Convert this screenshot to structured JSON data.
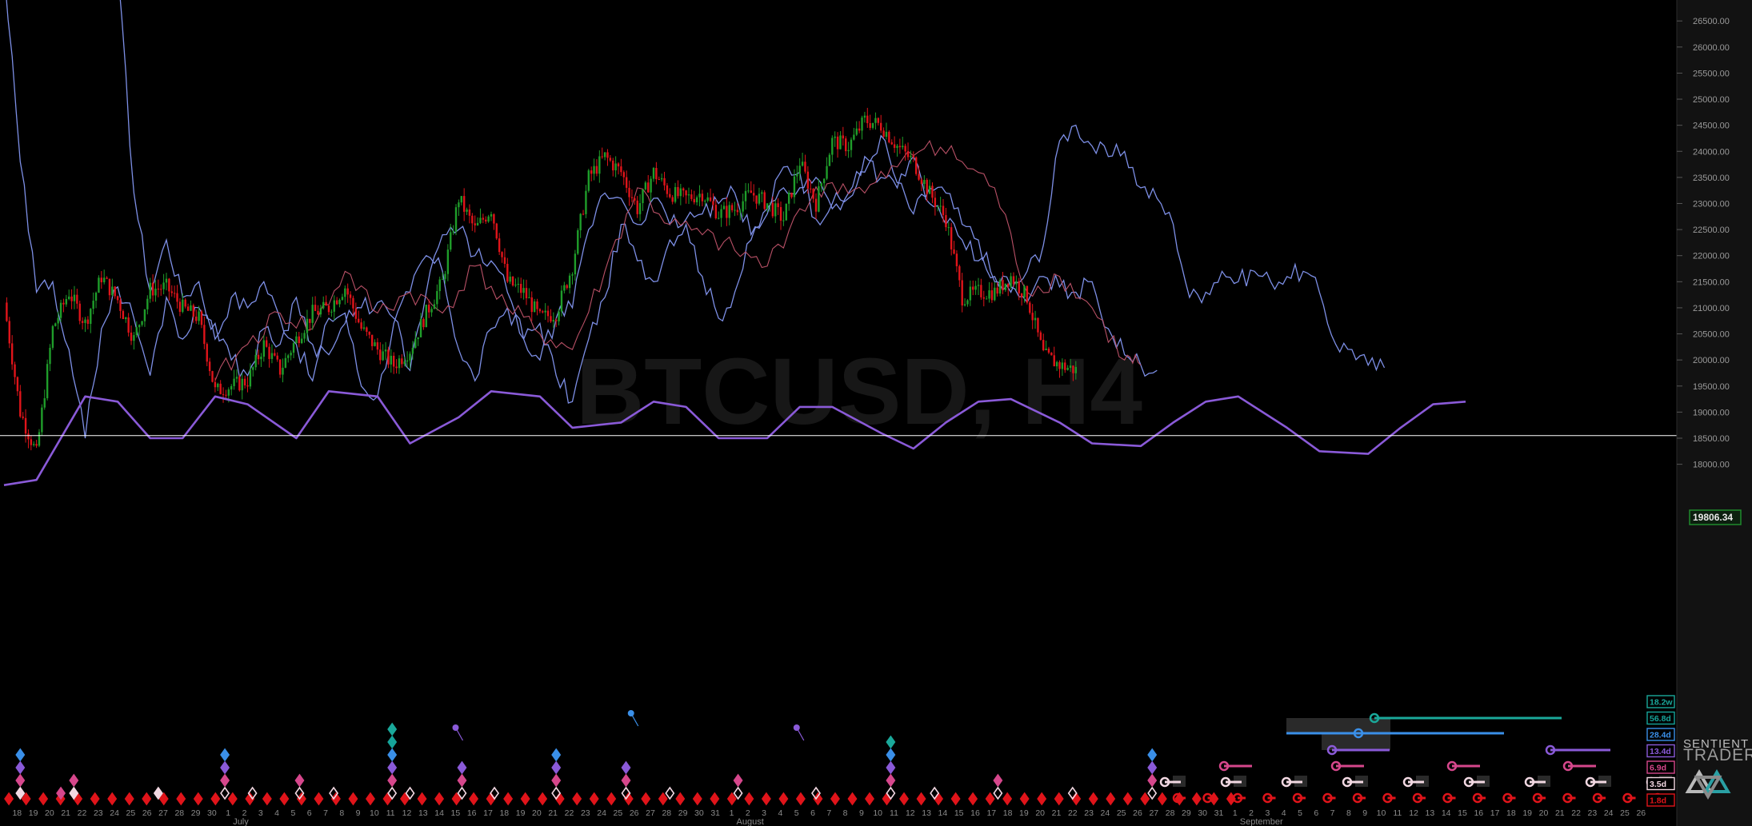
{
  "watermark": "BTCUSD, H4",
  "price_label": "19806.34",
  "brand": {
    "line1": "SENTIENT",
    "line2": "TRADER"
  },
  "colors": {
    "background": "#000000",
    "up_candle": "#1f9d2a",
    "down_candle": "#e0141a",
    "projection_blue": "#7d8fe6",
    "projection_red": "#b85066",
    "cycle_sine": "#8a5ad8",
    "reference_line": "#ffffff",
    "price_box": "#1f8a2c"
  },
  "chart_data": {
    "type": "line",
    "title": "BTCUSD, H4",
    "y_axis": {
      "side": "right",
      "ticks": [
        18000,
        18500,
        19000,
        19500,
        20000,
        20500,
        21000,
        21500,
        22000,
        22500,
        23000,
        23500,
        24000,
        24500,
        25000,
        25500,
        26000,
        26500
      ],
      "tick_labels": [
        "18000.00",
        "18500.00",
        "19000.00",
        "19500.00",
        "20000.00",
        "20500.00",
        "21000.00",
        "21500.00",
        "22000.00",
        "22500.00",
        "23000.00",
        "23500.00",
        "24000.00",
        "24500.00",
        "25000.00",
        "25500.00",
        "26000.00",
        "26500.00"
      ],
      "range": [
        17600,
        26700
      ]
    },
    "x_axis": {
      "day_labels": [
        "18",
        "19",
        "20",
        "21",
        "22",
        "23",
        "24",
        "25",
        "26",
        "27",
        "28",
        "29",
        "30",
        "1",
        "2",
        "3",
        "4",
        "5",
        "6",
        "7",
        "8",
        "9",
        "10",
        "11",
        "12",
        "13",
        "14",
        "15",
        "16",
        "17",
        "18",
        "19",
        "20",
        "21",
        "22",
        "23",
        "24",
        "25",
        "26",
        "27",
        "28",
        "29",
        "30",
        "31",
        "1",
        "2",
        "3",
        "4",
        "5",
        "6",
        "7",
        "8",
        "9",
        "10",
        "11",
        "12",
        "13",
        "14",
        "15",
        "16",
        "17",
        "18",
        "19",
        "20",
        "21",
        "22",
        "23",
        "24",
        "25",
        "26",
        "27",
        "28",
        "29",
        "30",
        "31",
        "1",
        "2",
        "3",
        "4",
        "5",
        "6",
        "7",
        "8",
        "9",
        "10",
        "11",
        "12",
        "13",
        "14",
        "15",
        "16",
        "17",
        "18",
        "19",
        "20",
        "21",
        "22",
        "23",
        "24",
        "25",
        "26"
      ],
      "months": [
        {
          "label": "July",
          "day_index": 13
        },
        {
          "label": "August",
          "day_index": 44
        },
        {
          "label": "September",
          "day_index": 75
        }
      ]
    },
    "price_close": [
      [
        0,
        21100
      ],
      [
        1,
        19000
      ],
      [
        2,
        18200
      ],
      [
        3,
        20600
      ],
      [
        4,
        21300
      ],
      [
        5,
        20700
      ],
      [
        6,
        21600
      ],
      [
        7,
        21150
      ],
      [
        8,
        20400
      ],
      [
        9,
        21350
      ],
      [
        10,
        21400
      ],
      [
        11,
        21000
      ],
      [
        12,
        20800
      ],
      [
        13,
        19400
      ],
      [
        14,
        19500
      ],
      [
        15,
        19600
      ],
      [
        16,
        20300
      ],
      [
        17,
        19800
      ],
      [
        18,
        20400
      ],
      [
        19,
        20900
      ],
      [
        20,
        21000
      ],
      [
        21,
        21400
      ],
      [
        22,
        20600
      ],
      [
        23,
        20200
      ],
      [
        24,
        19900
      ],
      [
        25,
        20200
      ],
      [
        26,
        20900
      ],
      [
        27,
        21500
      ],
      [
        28,
        23100
      ],
      [
        29,
        22500
      ],
      [
        30,
        22900
      ],
      [
        31,
        21500
      ],
      [
        32,
        21300
      ],
      [
        33,
        20800
      ],
      [
        34,
        20900
      ],
      [
        35,
        21800
      ],
      [
        36,
        23500
      ],
      [
        37,
        23900
      ],
      [
        38,
        23600
      ],
      [
        39,
        22900
      ],
      [
        40,
        23600
      ],
      [
        41,
        23200
      ],
      [
        42,
        23100
      ],
      [
        43,
        23200
      ],
      [
        44,
        22800
      ],
      [
        45,
        22900
      ],
      [
        46,
        23200
      ],
      [
        47,
        23000
      ],
      [
        48,
        22700
      ],
      [
        49,
        23800
      ],
      [
        50,
        23000
      ],
      [
        51,
        24200
      ],
      [
        52,
        24100
      ],
      [
        53,
        24600
      ],
      [
        54,
        24500
      ],
      [
        55,
        24100
      ],
      [
        56,
        23800
      ],
      [
        57,
        23200
      ],
      [
        58,
        22700
      ],
      [
        59,
        21200
      ],
      [
        60,
        21300
      ],
      [
        61,
        21300
      ],
      [
        62,
        21600
      ],
      [
        63,
        21200
      ],
      [
        64,
        20100
      ],
      [
        65,
        19900
      ],
      [
        66,
        19806
      ]
    ],
    "projection_red_1": [
      [
        13,
        19600
      ],
      [
        15,
        20300
      ],
      [
        17,
        20900
      ],
      [
        19,
        20600
      ],
      [
        21,
        21700
      ],
      [
        23,
        20900
      ],
      [
        25,
        21300
      ],
      [
        27,
        20900
      ],
      [
        29,
        21800
      ],
      [
        31,
        21000
      ],
      [
        33,
        20500
      ],
      [
        35,
        20200
      ],
      [
        37,
        21700
      ],
      [
        39,
        23300
      ],
      [
        41,
        22600
      ],
      [
        43,
        22400
      ],
      [
        45,
        22100
      ],
      [
        47,
        21800
      ],
      [
        49,
        22900
      ],
      [
        51,
        23400
      ],
      [
        53,
        23200
      ],
      [
        55,
        23700
      ],
      [
        57,
        24200
      ],
      [
        59,
        23800
      ],
      [
        61,
        23300
      ],
      [
        63,
        21300
      ],
      [
        65,
        21600
      ],
      [
        67,
        21000
      ],
      [
        69,
        20000
      ],
      [
        70,
        19900
      ]
    ],
    "projection_blue_1": [
      [
        0,
        27500
      ],
      [
        1,
        23800
      ],
      [
        2,
        21300
      ],
      [
        3,
        21500
      ],
      [
        4,
        20200
      ],
      [
        5,
        18500
      ],
      [
        6,
        20600
      ],
      [
        7,
        21400
      ],
      [
        8,
        20800
      ],
      [
        9,
        19700
      ],
      [
        10,
        21200
      ],
      [
        11,
        20400
      ],
      [
        12,
        21000
      ],
      [
        13,
        20700
      ],
      [
        14,
        20000
      ],
      [
        15,
        19700
      ],
      [
        16,
        20600
      ],
      [
        17,
        20300
      ],
      [
        18,
        21200
      ],
      [
        19,
        20300
      ],
      [
        20,
        20100
      ],
      [
        21,
        20700
      ],
      [
        22,
        21000
      ],
      [
        23,
        21100
      ],
      [
        24,
        20800
      ],
      [
        25,
        19800
      ],
      [
        26,
        21300
      ],
      [
        27,
        22400
      ],
      [
        28,
        22500
      ],
      [
        29,
        22000
      ],
      [
        30,
        21900
      ],
      [
        31,
        21300
      ],
      [
        32,
        20400
      ],
      [
        33,
        20000
      ],
      [
        34,
        20800
      ],
      [
        35,
        21000
      ],
      [
        36,
        22500
      ],
      [
        37,
        23200
      ],
      [
        38,
        23100
      ],
      [
        39,
        22600
      ],
      [
        40,
        23100
      ],
      [
        41,
        22600
      ],
      [
        42,
        22700
      ],
      [
        43,
        22800
      ],
      [
        44,
        23000
      ],
      [
        45,
        23200
      ],
      [
        46,
        22400
      ],
      [
        47,
        22800
      ],
      [
        48,
        23300
      ],
      [
        49,
        23300
      ],
      [
        50,
        23500
      ],
      [
        51,
        22900
      ],
      [
        52,
        23200
      ],
      [
        53,
        23900
      ],
      [
        54,
        23500
      ],
      [
        55,
        23300
      ],
      [
        56,
        23900
      ],
      [
        57,
        23000
      ],
      [
        58,
        22600
      ],
      [
        59,
        22300
      ],
      [
        60,
        21900
      ],
      [
        61,
        21600
      ],
      [
        62,
        21400
      ],
      [
        63,
        21100
      ],
      [
        64,
        21600
      ],
      [
        65,
        21400
      ],
      [
        66,
        21300
      ],
      [
        67,
        21500
      ],
      [
        68,
        20600
      ],
      [
        69,
        20100
      ],
      [
        70,
        19900
      ],
      [
        71,
        19800
      ]
    ],
    "projection_blue_2": [
      [
        7,
        27500
      ],
      [
        8,
        23200
      ],
      [
        9,
        21300
      ],
      [
        10,
        22300
      ],
      [
        11,
        21200
      ],
      [
        12,
        21500
      ],
      [
        13,
        20400
      ],
      [
        14,
        21200
      ],
      [
        15,
        21000
      ],
      [
        16,
        21500
      ],
      [
        17,
        20800
      ],
      [
        18,
        20300
      ],
      [
        19,
        19600
      ],
      [
        20,
        20800
      ],
      [
        21,
        20900
      ],
      [
        22,
        19500
      ],
      [
        23,
        19300
      ],
      [
        24,
        20700
      ],
      [
        25,
        21300
      ],
      [
        26,
        22000
      ],
      [
        27,
        21700
      ],
      [
        28,
        20200
      ],
      [
        29,
        19600
      ],
      [
        30,
        20600
      ],
      [
        31,
        21000
      ],
      [
        32,
        20400
      ],
      [
        33,
        20700
      ],
      [
        34,
        19700
      ],
      [
        35,
        19200
      ],
      [
        36,
        20400
      ],
      [
        37,
        21200
      ],
      [
        38,
        22600
      ],
      [
        39,
        21900
      ],
      [
        40,
        21500
      ],
      [
        41,
        22300
      ],
      [
        42,
        22600
      ],
      [
        43,
        21600
      ],
      [
        44,
        20800
      ],
      [
        45,
        21300
      ],
      [
        46,
        22300
      ],
      [
        47,
        22900
      ],
      [
        48,
        23700
      ],
      [
        49,
        23600
      ],
      [
        50,
        22700
      ],
      [
        51,
        23000
      ],
      [
        52,
        23100
      ],
      [
        53,
        23600
      ],
      [
        54,
        24300
      ],
      [
        55,
        23400
      ],
      [
        56,
        22800
      ],
      [
        57,
        23300
      ],
      [
        58,
        23200
      ],
      [
        59,
        22600
      ],
      [
        60,
        22300
      ],
      [
        61,
        21500
      ],
      [
        62,
        21300
      ],
      [
        63,
        21700
      ],
      [
        64,
        22200
      ],
      [
        65,
        24200
      ],
      [
        66,
        24500
      ],
      [
        67,
        24100
      ],
      [
        68,
        23900
      ],
      [
        69,
        24000
      ],
      [
        70,
        23300
      ],
      [
        71,
        23100
      ],
      [
        72,
        22600
      ],
      [
        73,
        21200
      ],
      [
        74,
        21300
      ],
      [
        75,
        21700
      ],
      [
        76,
        21500
      ],
      [
        77,
        21700
      ],
      [
        78,
        21500
      ],
      [
        79,
        21600
      ],
      [
        80,
        21700
      ],
      [
        81,
        21300
      ],
      [
        82,
        20300
      ],
      [
        83,
        20200
      ],
      [
        84,
        19900
      ],
      [
        85,
        19850
      ]
    ],
    "cycle_sine": [
      [
        0,
        17600
      ],
      [
        2,
        17700
      ],
      [
        5,
        19300
      ],
      [
        7,
        19200
      ],
      [
        9,
        18500
      ],
      [
        11,
        18500
      ],
      [
        13,
        19300
      ],
      [
        15,
        19150
      ],
      [
        18,
        18500
      ],
      [
        20,
        19400
      ],
      [
        23,
        19300
      ],
      [
        25,
        18400
      ],
      [
        28,
        18900
      ],
      [
        30,
        19400
      ],
      [
        33,
        19300
      ],
      [
        35,
        18700
      ],
      [
        38,
        18800
      ],
      [
        40,
        19200
      ],
      [
        42,
        19100
      ],
      [
        44,
        18500
      ],
      [
        47,
        18500
      ],
      [
        49,
        19100
      ],
      [
        51,
        19100
      ],
      [
        54,
        18600
      ],
      [
        56,
        18300
      ],
      [
        58,
        18800
      ],
      [
        60,
        19200
      ],
      [
        62,
        19250
      ],
      [
        65,
        18800
      ],
      [
        67,
        18400
      ],
      [
        70,
        18350
      ],
      [
        72,
        18800
      ],
      [
        74,
        19200
      ],
      [
        76,
        19300
      ],
      [
        79,
        18700
      ],
      [
        81,
        18250
      ],
      [
        84,
        18200
      ],
      [
        86,
        18700
      ],
      [
        88,
        19150
      ],
      [
        90,
        19200
      ]
    ],
    "reference_line": 18550,
    "cycle_panel": {
      "labels": [
        "18.2w",
        "56.8d",
        "28.4d",
        "13.4d",
        "6.9d",
        "3.5d",
        "1.8d"
      ],
      "colors": [
        "#1aa89a",
        "#16a49a",
        "#3a8fe8",
        "#8a5ad8",
        "#d6478c",
        "#f2d8e2",
        "#e0141a"
      ]
    }
  }
}
